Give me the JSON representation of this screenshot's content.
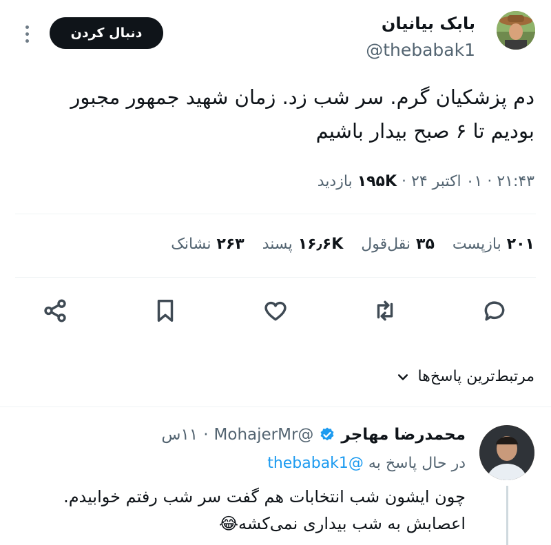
{
  "tweet": {
    "author_name": "بابک بیانیان",
    "author_handle": "@thebabak1",
    "follow_label": "دنبال کردن",
    "text_line1": "دم پزشکیان گرم. سر شب زد. زمان شهید جمهور مجبور",
    "text_line2": "بودیم تا ۶ صبح بیدار باشیم",
    "time": "۲۱:۴۳",
    "date": "۰۱ اکتبر ۲۴",
    "views_count": "۱۹۵K",
    "views_label": "بازدید",
    "separator": "·"
  },
  "stats": {
    "reposts_count": "۲۰۱",
    "reposts_label": "بازپست",
    "quotes_count": "۳۵",
    "quotes_label": "نقل‌قول",
    "likes_count": "۱۶٫۶K",
    "likes_label": "پسند",
    "bookmarks_count": "۲۶۳",
    "bookmarks_label": "نشانک"
  },
  "actions": [
    "reply-icon",
    "retweet-icon",
    "like-icon",
    "bookmark-icon",
    "share-icon"
  ],
  "replies_sort": {
    "label": "مرتبط‌ترین پاسخ‌ها"
  },
  "reply": {
    "author_name": "محمدرضا مهاجر",
    "author_handle": "@MohajerMr",
    "time_ago": "۱۱س",
    "separator": "·",
    "replying_prefix": "در حال پاسخ به",
    "replying_to": "@thebabak1",
    "text_line1": "چون ایشون شب انتخابات هم گفت سر شب رفتم خوابیدم.",
    "text_line2": "اعصابش به شب بیداری نمی‌کشه",
    "emoji": "😂"
  },
  "colors": {
    "text": "#0f1419",
    "muted": "#536471",
    "accent": "#1d9bf0",
    "follow_bg": "#0f1419"
  }
}
